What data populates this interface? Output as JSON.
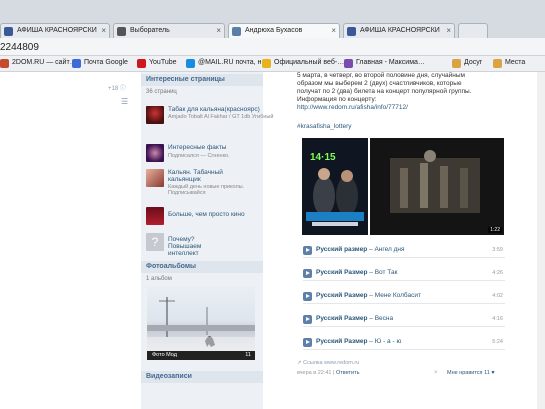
{
  "browser": {
    "tabs": [
      {
        "label": "АФИША КРАСНОЯРСКИ",
        "color": "#3b5998"
      },
      {
        "label": "Выборатель",
        "color": "#555555"
      },
      {
        "label": "Андрюха Бухасов",
        "color": "#5b7fa6"
      },
      {
        "label": "АФИША КРАСНОЯРСКИ",
        "color": "#3b5998"
      },
      {
        "label": "",
        "color": "#cccccc"
      }
    ],
    "url": "2244809",
    "bookmarks": [
      {
        "label": "2DOM.RU — сайт…",
        "color": "#c44d2e"
      },
      {
        "label": "Почта Google",
        "color": "#3d6ad6"
      },
      {
        "label": "YouTube",
        "color": "#cc181e"
      },
      {
        "label": "@MAIL.RU почта, н…",
        "color": "#168de2"
      },
      {
        "label": "Официальный веб-…",
        "color": "#e8b21c"
      },
      {
        "label": "Главная - Максима…",
        "color": "#7a4cae"
      },
      {
        "label": "Досуг",
        "color": "#d9a441"
      },
      {
        "label": "Места",
        "color": "#d9a441"
      }
    ]
  },
  "left": {
    "small1": "+18 ⓘ",
    "small2": "☰"
  },
  "interesting": {
    "header": "Интересные страницы",
    "count": "36 страниц",
    "groups": [
      {
        "name": "Табак для кальяна(красноярс)",
        "desc": "Amjado Tobalt Al Fakhar / GT 1db Угибный",
        "color": "#7a1a1a"
      },
      {
        "name": "Интересные факты",
        "desc": "Подписался — Сгненко.",
        "color": "#3a1050"
      },
      {
        "name": "Кальян. Табачный кальянщик",
        "desc": "Каждый день новые приколы. Подписывайся",
        "color": "#c2655a"
      },
      {
        "name": "Больше, чем просто кино",
        "desc": "",
        "color": "#8a1622"
      },
      {
        "name": "Почему? Повышаем интеллект",
        "desc": "",
        "color": "#c6c9cf"
      }
    ]
  },
  "photos": {
    "header": "Фотоальбомы",
    "count": "1 альбом",
    "album_title": "Фото Мод",
    "album_count": "11"
  },
  "videos_header": "Видеозаписи",
  "post": {
    "lines": [
      "5 марта, в четверг, во второй половине дня, случайным",
      "образом мы выберем 2 (двух) счастливчиков, которые",
      "получат по 2 (два) билета на концерт популярной группы.",
      "Информация по концерту:"
    ],
    "link": "http://www.redom.ru/afisha/info/77712/",
    "hashtag": "#krasafisha_lottery",
    "video_duration": "1:22",
    "tracks": [
      {
        "artist": "Русский размер",
        "title": "Ангел дня",
        "dur": "3:59"
      },
      {
        "artist": "Русский Размер",
        "title": "Вот Так",
        "dur": "4:26"
      },
      {
        "artist": "Русский Размер",
        "title": "Мене Колбасит",
        "dur": "4:02"
      },
      {
        "artist": "Русский Размер",
        "title": "Весна",
        "dur": "4:16"
      },
      {
        "artist": "Русский Размер",
        "title": "Ю - а - ю",
        "dur": "5:24"
      }
    ],
    "source": "Ссылка www.redom.ru",
    "time": "вчера в 22:41",
    "reply": "Ответить",
    "like": "Мне нравится 11"
  }
}
